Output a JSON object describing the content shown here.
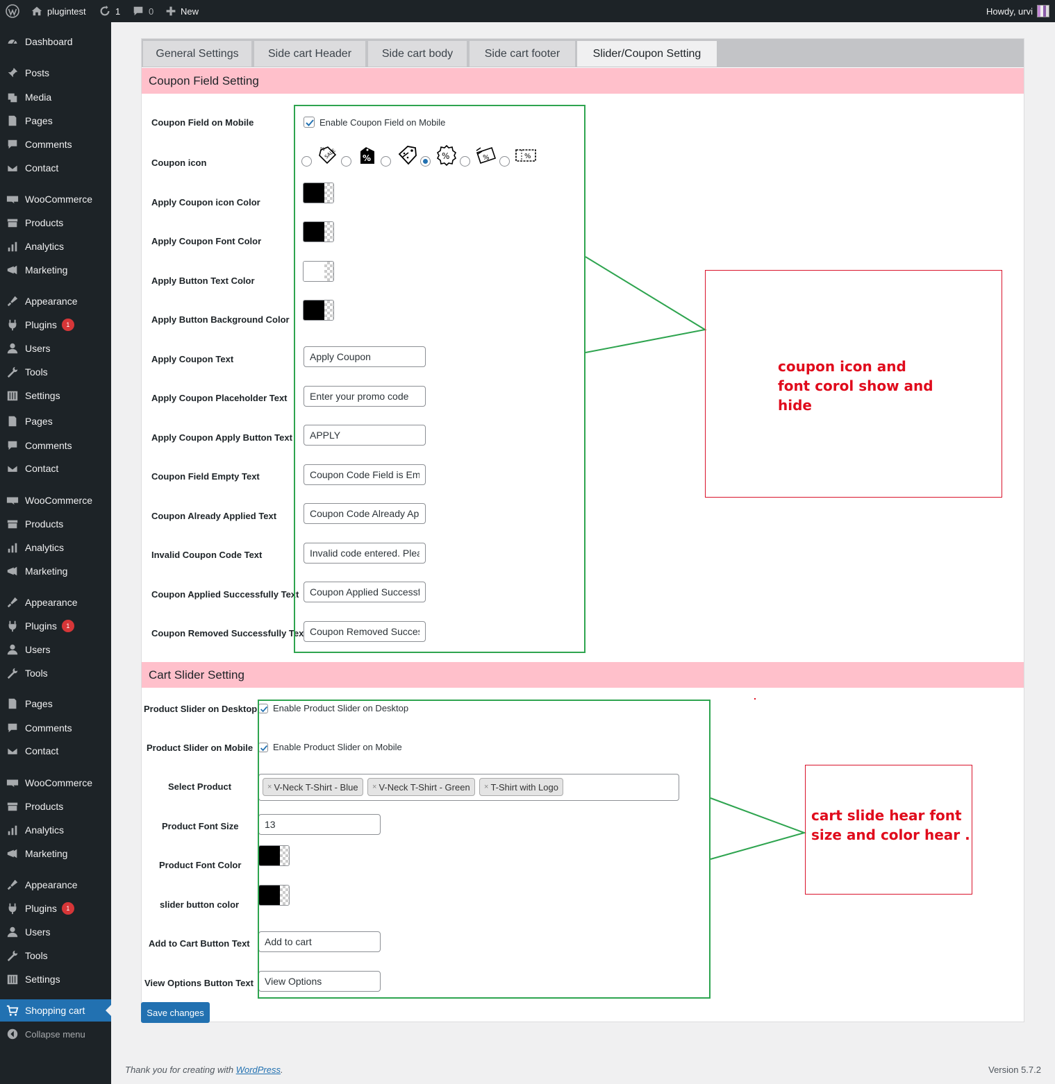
{
  "adminbar": {
    "site_name": "plugintest",
    "updates_count": "1",
    "comments_count": "0",
    "new_label": "New",
    "howdy": "Howdy, urvi"
  },
  "menu": [
    {
      "label": "Dashboard",
      "icon": "dashboard-icon"
    },
    {
      "label": "Posts",
      "icon": "pin-icon"
    },
    {
      "label": "Media",
      "icon": "media-icon"
    },
    {
      "label": "Pages",
      "icon": "page-icon"
    },
    {
      "label": "Comments",
      "icon": "comment-icon"
    },
    {
      "label": "Contact",
      "icon": "mail-icon"
    },
    {
      "label": "WooCommerce",
      "icon": "woo-icon"
    },
    {
      "label": "Products",
      "icon": "archive-icon"
    },
    {
      "label": "Analytics",
      "icon": "bar-chart-icon"
    },
    {
      "label": "Marketing",
      "icon": "megaphone-icon"
    },
    {
      "label": "Appearance",
      "icon": "brush-icon"
    },
    {
      "label": "Plugins",
      "icon": "plug-icon",
      "badge": "1"
    },
    {
      "label": "Users",
      "icon": "user-icon"
    },
    {
      "label": "Tools",
      "icon": "wrench-icon"
    },
    {
      "label": "Settings",
      "icon": "sliders-icon"
    },
    {
      "label": "Pages",
      "icon": "page-icon"
    },
    {
      "label": "Comments",
      "icon": "comment-icon"
    },
    {
      "label": "Contact",
      "icon": "mail-icon"
    },
    {
      "label": "WooCommerce",
      "icon": "woo-icon"
    },
    {
      "label": "Products",
      "icon": "archive-icon"
    },
    {
      "label": "Analytics",
      "icon": "bar-chart-icon"
    },
    {
      "label": "Marketing",
      "icon": "megaphone-icon"
    },
    {
      "label": "Appearance",
      "icon": "brush-icon"
    },
    {
      "label": "Plugins",
      "icon": "plug-icon",
      "badge": "1"
    },
    {
      "label": "Users",
      "icon": "user-icon"
    },
    {
      "label": "Tools",
      "icon": "wrench-icon"
    },
    {
      "label": "Pages",
      "icon": "page-icon"
    },
    {
      "label": "Comments",
      "icon": "comment-icon"
    },
    {
      "label": "Contact",
      "icon": "mail-icon"
    },
    {
      "label": "WooCommerce",
      "icon": "woo-icon"
    },
    {
      "label": "Products",
      "icon": "archive-icon"
    },
    {
      "label": "Analytics",
      "icon": "bar-chart-icon"
    },
    {
      "label": "Marketing",
      "icon": "megaphone-icon"
    },
    {
      "label": "Appearance",
      "icon": "brush-icon"
    },
    {
      "label": "Plugins",
      "icon": "plug-icon",
      "badge": "1"
    },
    {
      "label": "Users",
      "icon": "user-icon"
    },
    {
      "label": "Tools",
      "icon": "wrench-icon"
    },
    {
      "label": "Settings",
      "icon": "sliders-icon"
    },
    {
      "label": "Shopping cart",
      "icon": "cart-icon",
      "active": true
    },
    {
      "label": "Collapse menu",
      "icon": "collapse-icon"
    }
  ],
  "tabs": [
    {
      "label": "General Settings",
      "active": false
    },
    {
      "label": "Side cart Header",
      "active": false
    },
    {
      "label": "Side cart body",
      "active": false
    },
    {
      "label": "Side cart footer",
      "active": false
    },
    {
      "label": "Slider/Coupon Setting",
      "active": true
    }
  ],
  "coupon": {
    "heading": "Coupon Field Setting",
    "mobile_label": "Coupon Field on Mobile",
    "mobile_check": "Enable Coupon Field on Mobile",
    "icon_label": "Coupon icon",
    "icon_options": [
      "sale-tag-icon",
      "percent-tag-icon",
      "discount-tag-icon",
      "percent-badge-icon",
      "percent-ticket-icon",
      "coupon-ticket-icon"
    ],
    "icon_selected_index": 3,
    "icon_color_label": "Apply Coupon icon Color",
    "font_color_label": "Apply Coupon Font Color",
    "button_text_color_label": "Apply Button Text Color",
    "button_bg_color_label": "Apply Button Background Color",
    "colors": {
      "icon": "#000000",
      "font": "#000000",
      "button_text": "#ffffff",
      "button_bg": "#000000"
    },
    "apply_text_label": "Apply Coupon Text",
    "apply_text_value": "Apply Coupon",
    "placeholder_label": "Apply Coupon Placeholder Text",
    "placeholder_value": "Enter your promo code",
    "apply_button_label": "Apply Coupon Apply Button Text",
    "apply_button_value": "APPLY",
    "empty_label": "Coupon Field Empty Text",
    "empty_value": "Coupon Code Field is Emp",
    "already_label": "Coupon Already Applied Text",
    "already_value": "Coupon Code Already Ap",
    "invalid_label": "Invalid Coupon Code Text",
    "invalid_value": "Invalid code entered. Plea",
    "success_label": "Coupon Applied Successfully Text",
    "success_value": "Coupon Applied Successf",
    "removed_label": "Coupon Removed Successfully Text",
    "removed_value": "Coupon Removed Succes"
  },
  "slider": {
    "heading": "Cart Slider Setting",
    "desktop_label": "Product Slider on Desktop",
    "desktop_check": "Enable Product Slider on Desktop",
    "mobile_label": "Product Slider on Mobile",
    "mobile_check": "Enable Product Slider on Mobile",
    "select_label": "Select Product",
    "products": [
      "V-Neck T-Shirt - Blue",
      "V-Neck T-Shirt - Green",
      "T-Shirt with Logo"
    ],
    "font_size_label": "Product Font Size",
    "font_size_value": "13",
    "font_color_label": "Product Font Color",
    "button_color_label": "slider button color",
    "colors": {
      "font": "#000000",
      "button": "#000000"
    },
    "add_to_cart_label": "Add to Cart Button Text",
    "add_to_cart_value": "Add to cart",
    "view_options_label": "View Options Button Text",
    "view_options_value": "View Options"
  },
  "save_label": "Save changes",
  "annotations": {
    "note1": [
      "coupon icon and",
      "font corol show and",
      "hide"
    ],
    "note2": [
      "cart slide hear font",
      "size and color hear ."
    ],
    "green": "#2ea44f",
    "red": "#e00b1c"
  },
  "footer": {
    "thanks_prefix": "Thank you for creating with ",
    "thanks_link": "WordPress",
    "thanks_suffix": ".",
    "version": "Version 5.7.2"
  },
  "brand": {
    "accent": "#2271b1",
    "section_bg": "#ffc0cb",
    "menu_bg": "#1d2327"
  }
}
